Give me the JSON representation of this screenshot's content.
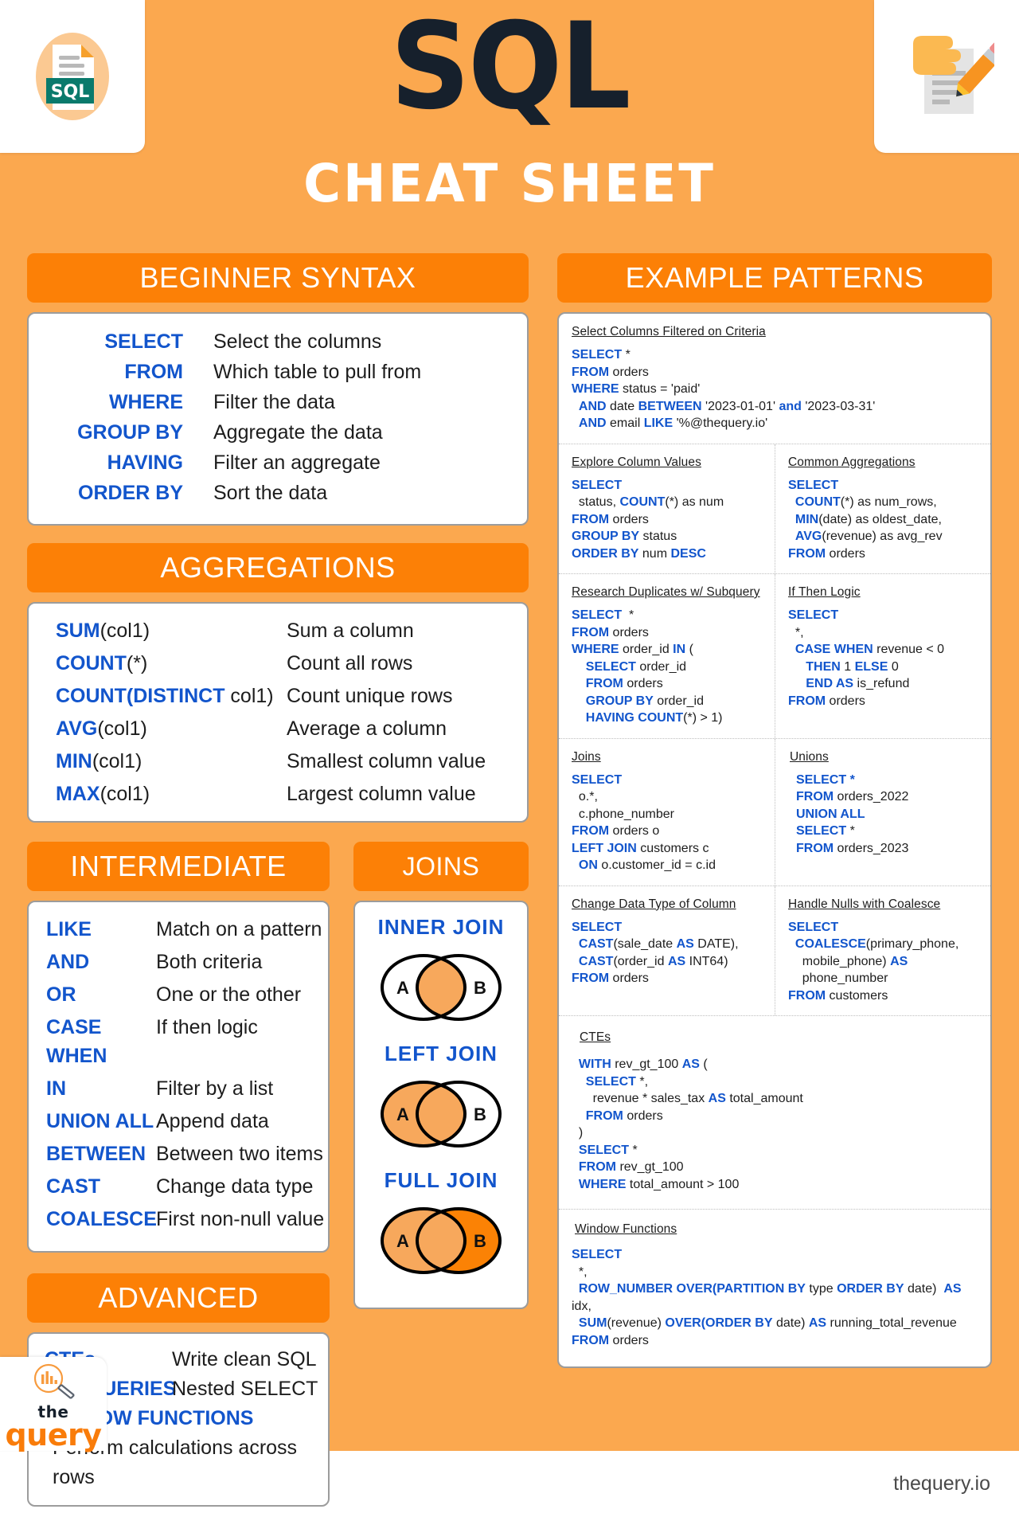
{
  "header": {
    "title": "SQL",
    "subtitle": "CHEAT SHEET",
    "logo_badge_text": "SQL",
    "left_icon": "sql-document-icon",
    "right_icon": "document-pencil-icon"
  },
  "colors": {
    "background": "#FBA84F",
    "pill": "#FC8006",
    "keyword_blue": "#1255CC",
    "card_border": "#9C9C9C",
    "title_dark": "#16202C",
    "venn_fill_light": "#F7A85C",
    "venn_fill_dark": "#FB8205",
    "logo_orange": "#F97C0A"
  },
  "sections": {
    "beginner": {
      "heading": "BEGINNER SYNTAX",
      "rows": [
        {
          "keyword": "SELECT",
          "desc": "Select the columns"
        },
        {
          "keyword": "FROM",
          "desc": "Which table to pull from"
        },
        {
          "keyword": "WHERE",
          "desc": "Filter the data"
        },
        {
          "keyword": "GROUP BY",
          "desc": "Aggregate the data"
        },
        {
          "keyword": "HAVING",
          "desc": "Filter an aggregate"
        },
        {
          "keyword": "ORDER BY",
          "desc": "Sort the data"
        }
      ]
    },
    "aggregations": {
      "heading": "AGGREGATIONS",
      "rows": [
        {
          "fn": "SUM",
          "arg": "(col1)",
          "desc": "Sum a column"
        },
        {
          "fn": "COUNT",
          "arg": "(*)",
          "desc": "Count all rows"
        },
        {
          "fn": "COUNT(DISTINCT",
          "arg": " col1)",
          "desc": "Count unique rows"
        },
        {
          "fn": "AVG",
          "arg": "(col1)",
          "desc": "Average a column"
        },
        {
          "fn": "MIN",
          "arg": "(col1)",
          "desc": "Smallest column value"
        },
        {
          "fn": "MAX",
          "arg": "(col1)",
          "desc": "Largest column value"
        }
      ]
    },
    "intermediate": {
      "heading": "INTERMEDIATE",
      "rows": [
        {
          "keyword": "LIKE",
          "desc": "Match on a pattern"
        },
        {
          "keyword": "AND",
          "desc": "Both criteria"
        },
        {
          "keyword": "OR",
          "desc": "One or the other"
        },
        {
          "keyword": "CASE WHEN",
          "desc": "If then logic"
        },
        {
          "keyword": "IN",
          "desc": "Filter by a list"
        },
        {
          "keyword": "UNION ALL",
          "desc": "Append data"
        },
        {
          "keyword": "BETWEEN",
          "desc": "Between two items"
        },
        {
          "keyword": "CAST",
          "desc": "Change data type"
        },
        {
          "keyword": "COALESCE",
          "desc": "First non-null value"
        }
      ]
    },
    "joins": {
      "heading": "JOINS",
      "diagrams": [
        {
          "label": "INNER JOIN",
          "left_label": "A",
          "right_label": "B",
          "fill": "intersection"
        },
        {
          "label": "LEFT JOIN",
          "left_label": "A",
          "right_label": "B",
          "fill": "left-and-intersection"
        },
        {
          "label": "FULL  JOIN",
          "left_label": "A",
          "right_label": "B",
          "fill": "both"
        }
      ]
    },
    "advanced": {
      "heading": "ADVANCED",
      "rows": [
        {
          "keyword": "CTEs",
          "desc": "Write clean SQL"
        },
        {
          "keyword": "SUBQUERIES",
          "desc": "Nested SELECT"
        }
      ],
      "full_keyword": "WINDOW FUNCTIONS",
      "full_note": "Perform calculations across rows"
    },
    "examples": {
      "heading": "EXAMPLE PATTERNS",
      "blocks": [
        {
          "title": "Select Columns Filtered on Criteria",
          "layout": "full",
          "code": "<b>SELECT</b> *\n<b>FROM</b> orders\n<b>WHERE</b> status = 'paid'\n  <b>AND</b> date <b>BETWEEN</b> '2023-01-01' <b>and</b> '2023-03-31'\n  <b>AND</b> email <b>LIKE</b> '%@thequery.io'"
        },
        {
          "title": "Explore Column Values",
          "layout": "half",
          "code": "<b>SELECT</b>\n  status, <b>COUNT</b>(*) as num\n<b>FROM</b> orders\n<b>GROUP BY</b> status\n<b>ORDER BY</b> num <b>DESC</b>"
        },
        {
          "title": "Common Aggregations",
          "layout": "half",
          "code": "<b>SELECT</b>\n  <b>COUNT</b>(*) as num_rows,\n  <b>MIN</b>(date) as oldest_date,\n  <b>AVG</b>(revenue) as avg_rev\n<b>FROM</b> orders"
        },
        {
          "title": "Research Duplicates w/ Subquery",
          "layout": "half",
          "code": "<b>SELECT</b>  *\n<b>FROM</b> orders\n<b>WHERE</b> order_id <b>IN</b> (\n    <b>SELECT</b> order_id\n    <b>FROM</b> orders\n    <b>GROUP BY</b> order_id\n    <b>HAVING COUNT</b>(*) > 1)"
        },
        {
          "title": "If Then Logic",
          "layout": "half",
          "code": "<b>SELECT</b>\n  *,\n  <b>CASE WHEN</b> revenue &lt; 0\n     <b>THEN</b> 1 <b>ELSE</b> 0\n     <b>END AS</b> is_refund\n<b>FROM</b> orders"
        },
        {
          "title": "Joins",
          "layout": "half",
          "code": "<b>SELECT</b>\n  o.*,\n  c.phone_number\n<b>FROM</b> orders o\n<b>LEFT JOIN</b> customers c\n  <b>ON</b> o.customer_id = c.id"
        },
        {
          "title": "Unions",
          "layout": "half",
          "code": "<b>SELECT *</b>\n<b>FROM</b> orders_2022\n<b>UNION ALL</b>\n<b>SELECT</b> *\n<b>FROM</b> orders_2023"
        },
        {
          "title": "Change Data Type of Column",
          "layout": "half",
          "code": "<b>SELECT</b>\n  <b>CAST</b>(sale_date <b>AS</b> DATE),\n  <b>CAST</b>(order_id <b>AS</b> INT64)\n<b>FROM</b> orders"
        },
        {
          "title": "Handle Nulls with Coalesce",
          "layout": "half",
          "code": "<b>SELECT</b>\n  <b>COALESCE</b>(primary_phone,\n    mobile_phone) <b>AS</b>\n    phone_number\n<b>FROM</b> customers"
        },
        {
          "title": "CTEs",
          "layout": "full",
          "code": "  <b>WITH</b> rev_gt_100 <b>AS</b> (\n    <b>SELECT</b> *,\n      revenue * sales_tax <b>AS</b> total_amount\n    <b>FROM</b> orders\n  )\n  <b>SELECT</b> *\n  <b>FROM</b> rev_gt_100\n  <b>WHERE</b> total_amount > 100"
        },
        {
          "title": "Window Functions",
          "layout": "full",
          "code": "<b>SELECT</b>\n  *,\n  <b>ROW_NUMBER OVER(PARTITION BY</b> type <b>ORDER BY</b> date)  <b>AS</b> idx,\n  <b>SUM</b>(revenue) <b>OVER(ORDER BY</b> date) <b>AS</b> running_total_revenue\n<b>FROM</b> orders"
        }
      ]
    }
  },
  "footer": {
    "logo_line1": "the",
    "logo_line2": "query",
    "website": "thequery.io"
  }
}
